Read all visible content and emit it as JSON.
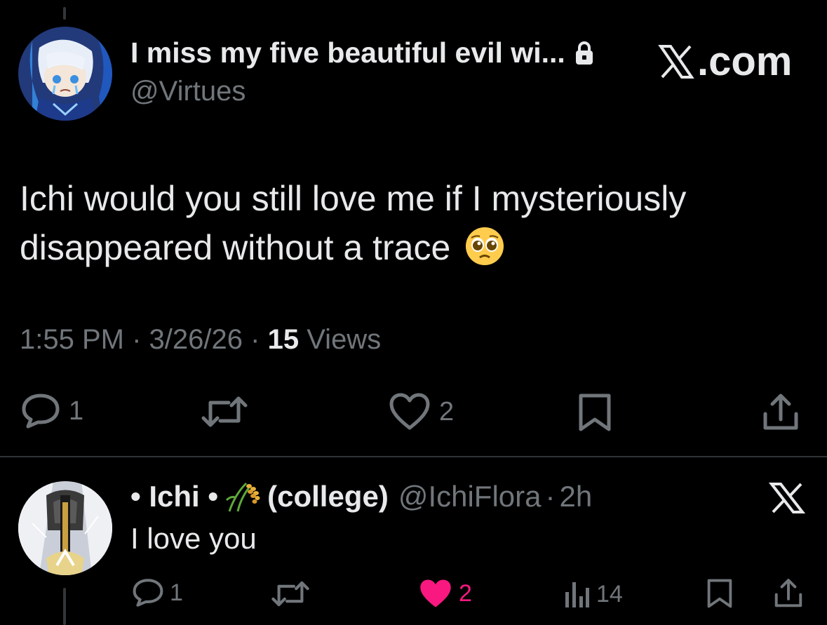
{
  "tweet": {
    "display_name": "I miss my five beautiful evil wi...",
    "handle": "@Virtues",
    "brand": ".com",
    "text_line1": "Ichi would you still love me if I mysteriously",
    "text_line2": "disappeared without a trace",
    "time": "1:55 PM",
    "date": "3/26/26",
    "views_count": "15",
    "views_label": "Views",
    "separator": "·",
    "actions": {
      "replies": "1",
      "likes": "2"
    }
  },
  "reply": {
    "name_prefix": "• Ichi •",
    "name_suffix": "(college)",
    "handle": "@IchiFlora",
    "separator": "·",
    "age": "2h",
    "text": "I love you",
    "actions": {
      "replies": "1",
      "likes": "2",
      "views": "14"
    }
  },
  "colors": {
    "background": "#000000",
    "text": "#e7e9ea",
    "muted": "#71767b",
    "like_active": "#f91880"
  },
  "icons": [
    "lock-icon",
    "x-logo-icon",
    "pleading-face-emoji",
    "reply-icon",
    "retweet-icon",
    "heart-icon",
    "bookmark-icon",
    "share-icon",
    "rice-icon",
    "views-icon"
  ]
}
